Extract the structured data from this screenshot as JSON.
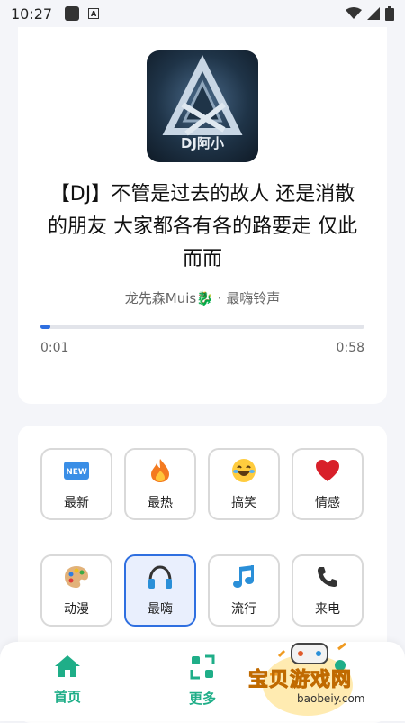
{
  "status_bar": {
    "time": "10:27"
  },
  "player": {
    "title": "【DJ】不管是过去的故人 还是消散的朋友 大家都各有各的路要走 仅此而而",
    "artist_line": "龙先森Muis🐉 · 最嗨铃声",
    "current_time": "0:01",
    "total_time": "0:58",
    "progress": 0.03,
    "cover_text": "DJ阿小"
  },
  "categories": [
    {
      "label": "最新",
      "icon": "new-badge-icon",
      "active": false
    },
    {
      "label": "最热",
      "icon": "fire-icon",
      "active": false
    },
    {
      "label": "搞笑",
      "icon": "laughing-face-icon",
      "active": false
    },
    {
      "label": "情感",
      "icon": "heart-icon",
      "active": false
    },
    {
      "label": "动漫",
      "icon": "palette-icon",
      "active": false
    },
    {
      "label": "最嗨",
      "icon": "headphones-icon",
      "active": true
    },
    {
      "label": "流行",
      "icon": "music-note-icon",
      "active": false
    },
    {
      "label": "来电",
      "icon": "phone-icon",
      "active": false
    }
  ],
  "nav": {
    "home_label": "首页",
    "more_label": "更多"
  },
  "watermark": {
    "text": "宝贝游戏网",
    "url": "baobeiy.com"
  },
  "colors": {
    "accent": "#2f6fe0",
    "nav_green": "#1fae88",
    "background": "#f4f5f9"
  }
}
